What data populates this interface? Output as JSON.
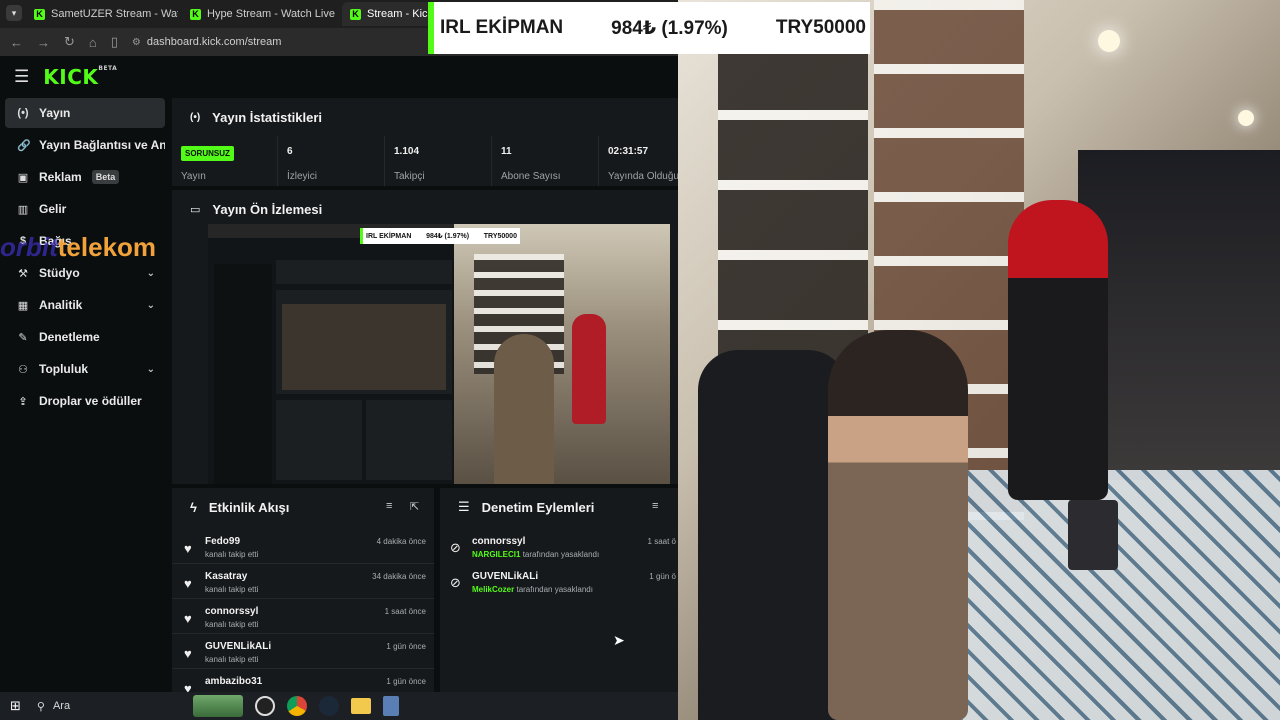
{
  "browser": {
    "tabs": [
      {
        "label": "SametUZER Stream - Watch Live",
        "favicon": "kick"
      },
      {
        "label": "Hype Stream - Watch Live o",
        "favicon": "kick"
      },
      {
        "label": "Stream - Kick Das",
        "favicon": "kick"
      }
    ],
    "url": "dashboard.kick.com/stream"
  },
  "overlay": {
    "ticker_title": "IRL EKİPMAN",
    "ticker_value": "984₺ (1.97%)",
    "ticker_goal": "TRY50000",
    "ticker_accent": "#53fc18",
    "sponsor_part1": "orbit",
    "sponsor_part2": "telekom"
  },
  "header": {
    "logo": "KICK",
    "logo_sup": "BETA"
  },
  "sidebar": {
    "items": [
      {
        "label": "Yayın",
        "icon": "broadcast-icon",
        "active": true
      },
      {
        "label": "Yayın Bağlantısı ve Anahtarı",
        "icon": "link-icon"
      },
      {
        "label": "Reklam",
        "icon": "ad-icon",
        "badge": "Beta"
      },
      {
        "label": "Gelir",
        "icon": "revenue-icon"
      },
      {
        "label": "Bağış",
        "icon": "donation-icon"
      },
      {
        "label": "Stüdyo",
        "icon": "studio-icon",
        "expandable": true
      },
      {
        "label": "Analitik",
        "icon": "analytics-icon",
        "expandable": true
      },
      {
        "label": "Denetleme",
        "icon": "moderation-icon"
      },
      {
        "label": "Topluluk",
        "icon": "community-icon",
        "expandable": true
      },
      {
        "label": "Droplar ve ödüller",
        "icon": "drops-icon"
      }
    ]
  },
  "stats": {
    "title": "Yayın İstatistikleri",
    "status_badge": "SORUNSUZ",
    "status_label": "Yayın",
    "viewers_value": "6",
    "viewers_label": "İzleyici",
    "followers_value": "1.104",
    "followers_label": "Takipçi",
    "subs_value": "11",
    "subs_label": "Abone Sayısı",
    "duration_value": "02:31:57",
    "duration_label": "Yayında Olduğu Süre"
  },
  "preview": {
    "title": "Yayın Ön İzlemesi"
  },
  "activity": {
    "title": "Etkinlik Akışı",
    "items": [
      {
        "name": "Fedo99",
        "action": "kanalı takip etti",
        "time": "4 dakika önce"
      },
      {
        "name": "Kasatray",
        "action": "kanalı takip etti",
        "time": "34 dakika önce"
      },
      {
        "name": "connorssyl",
        "action": "kanalı takip etti",
        "time": "1 saat önce"
      },
      {
        "name": "GUVENLikALi",
        "action": "kanalı takip etti",
        "time": "1 gün önce"
      },
      {
        "name": "ambazibo31",
        "action": "",
        "time": "1 gün önce"
      }
    ]
  },
  "moderation": {
    "title": "Denetim Eylemleri",
    "items": [
      {
        "name": "connorssyl",
        "moderator": "NARGILECI1",
        "action": "tarafından yasaklandı",
        "time": "1 saat ö"
      },
      {
        "name": "GUVENLikALi",
        "moderator": "MelikCozer",
        "action": "tarafından yasaklandı",
        "time": "1 gün ö"
      }
    ]
  },
  "taskbar": {
    "search_label": "Ara"
  }
}
